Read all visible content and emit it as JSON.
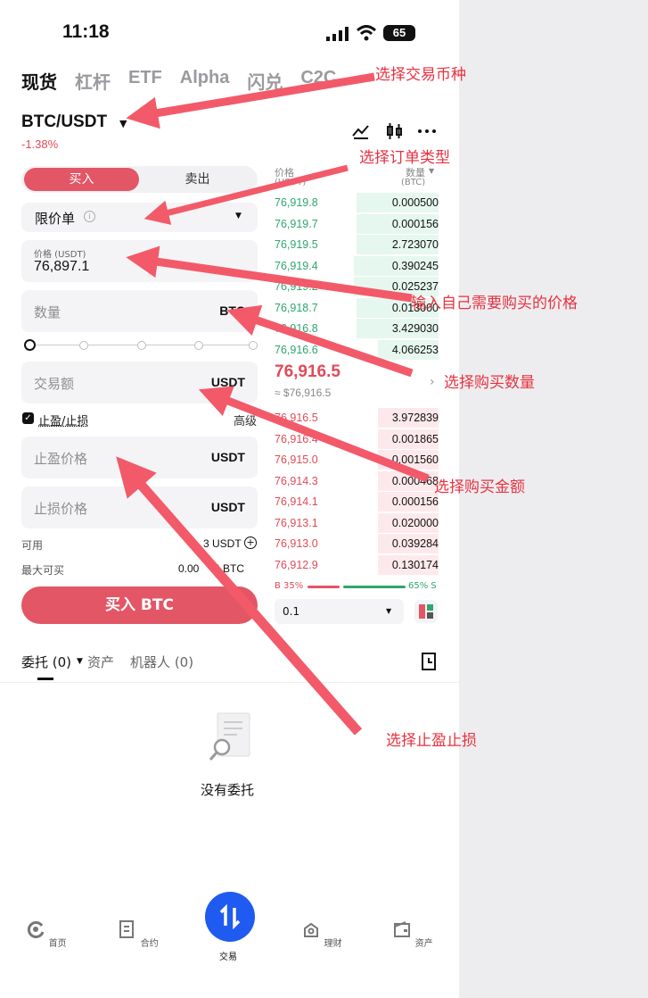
{
  "status_bar": {
    "time": "11:18",
    "battery": "65"
  },
  "top_tabs": [
    "现货",
    "杠杆",
    "ETF",
    "Alpha",
    "闪兑",
    "C2C"
  ],
  "pair": {
    "name": "BTC/USDT",
    "change": "-1.38%"
  },
  "order_toggle": {
    "buy": "买入",
    "sell": "卖出"
  },
  "order_type": "限价单",
  "price_field": {
    "label": "价格 (USDT)",
    "value": "76,897.1"
  },
  "amount_field": {
    "placeholder": "数量",
    "unit": "BTC"
  },
  "total_field": {
    "placeholder": "交易额",
    "unit": "USDT"
  },
  "tp_sl": {
    "label": "止盈/止损",
    "advanced": "高级",
    "tp_placeholder": "止盈价格",
    "sl_placeholder": "止损价格",
    "unit": "USDT"
  },
  "available": {
    "label": "可用",
    "value": "3 USDT"
  },
  "max_buy": {
    "label": "最大可买",
    "value_a": "0.00",
    "value_b": "4 BTC"
  },
  "buy_button": "买入 BTC",
  "orderbook": {
    "header_price": "价格",
    "header_price_unit": "(USDT)",
    "header_qty": "数量",
    "header_qty_unit": "(BTC)",
    "bids": [
      {
        "price": "76,919.8",
        "qty": "0.000500"
      },
      {
        "price": "76,919.7",
        "qty": "0.000156"
      },
      {
        "price": "76,919.5",
        "qty": "2.723070"
      },
      {
        "price": "76,919.4",
        "qty": "0.390245"
      },
      {
        "price": "76,919.2",
        "qty": "0.025237"
      },
      {
        "price": "76,918.7",
        "qty": "0.013000"
      },
      {
        "price": "76,916.8",
        "qty": "3.429030"
      },
      {
        "price": "76,916.6",
        "qty": "4.066253"
      }
    ],
    "last_price": "76,916.5",
    "last_price_usd": "≈ $76,916.5",
    "asks": [
      {
        "price": "76,916.5",
        "qty": "3.972839"
      },
      {
        "price": "76,916.4",
        "qty": "0.001865"
      },
      {
        "price": "76,915.0",
        "qty": "0.001560"
      },
      {
        "price": "76,914.3",
        "qty": "0.000468"
      },
      {
        "price": "76,914.1",
        "qty": "0.000156"
      },
      {
        "price": "76,913.1",
        "qty": "0.020000"
      },
      {
        "price": "76,913.0",
        "qty": "0.039284"
      },
      {
        "price": "76,912.9",
        "qty": "0.130174"
      }
    ],
    "ratio_buy": "B 35%",
    "ratio_sell": "65% S",
    "depth": "0.1"
  },
  "bottom_tabs": {
    "orders": "委托 (0)",
    "assets": "资产",
    "bots": "机器人 (0)"
  },
  "empty_text": "没有委托",
  "bottom_nav": [
    "首页",
    "合约",
    "交易",
    "理财",
    "资产"
  ],
  "annotations": {
    "pair": "选择交易币种",
    "order_type": "选择订单类型",
    "price": "输入自己需要购买的价格",
    "amount": "选择购买数量",
    "total": "选择购买金额",
    "tpsl": "选择止盈止损"
  },
  "colors": {
    "buy": "#e35665",
    "green": "#2ea66d",
    "annotation": "#e8323f",
    "nav_active": "#1f5bf0"
  }
}
